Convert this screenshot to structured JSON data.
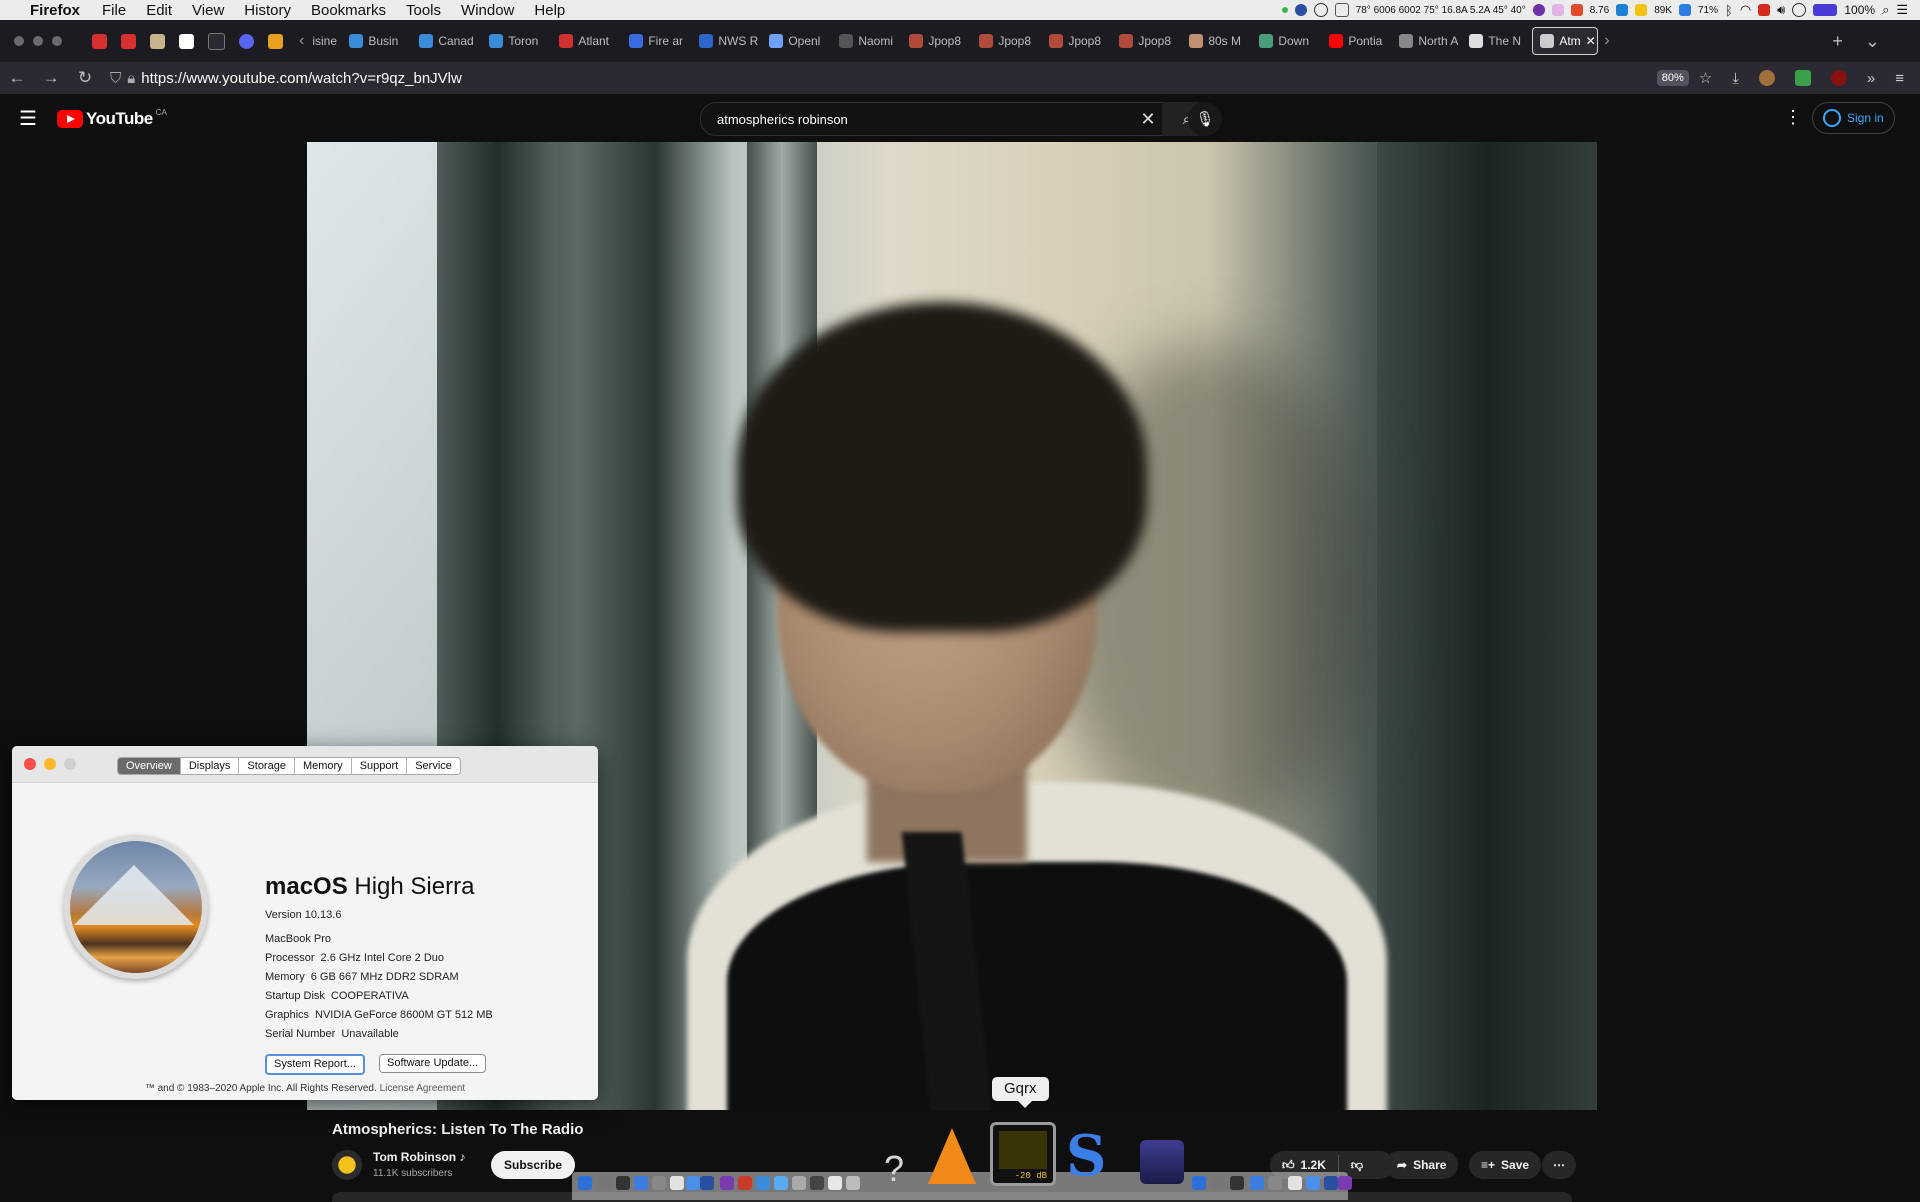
{
  "menubar": {
    "app": "Firefox",
    "items": [
      "File",
      "Edit",
      "View",
      "History",
      "Bookmarks",
      "Tools",
      "Window",
      "Help"
    ],
    "status": {
      "weather": "78° 6006 6002 75° 16.8A 5.2A 45° 40°",
      "stat1": "8.76",
      "stat2": "89K",
      "stat3": "71%",
      "battery": "100%"
    }
  },
  "tabs": [
    {
      "label": "Busin",
      "color": "#3a8bd8"
    },
    {
      "label": "Canad",
      "color": "#3a8bd8"
    },
    {
      "label": "Toron",
      "color": "#3a8bd8"
    },
    {
      "label": "Atlant",
      "color": "#d03030"
    },
    {
      "label": "Fire ar",
      "color": "#3a6be0"
    },
    {
      "label": "NWS R",
      "color": "#2c66c9"
    },
    {
      "label": "Openl",
      "color": "#6fa0ff"
    },
    {
      "label": "Naomi",
      "color": "#555555"
    },
    {
      "label": "Jpop8",
      "color": "#b04a3a"
    },
    {
      "label": "Jpop8",
      "color": "#b04a3a"
    },
    {
      "label": "Jpop8",
      "color": "#b04a3a"
    },
    {
      "label": "Jpop8",
      "color": "#b04a3a"
    },
    {
      "label": "80s M",
      "color": "#c09070"
    },
    {
      "label": "Down",
      "color": "#4a9c7a"
    },
    {
      "label": "Pontia",
      "color": "#ff0000"
    },
    {
      "label": "North Am",
      "color": "#888888"
    },
    {
      "label": "The N",
      "color": "#dddddd"
    },
    {
      "label": "Atm",
      "color": "#cccccc"
    }
  ],
  "tabs_partial": "isine",
  "navbar": {
    "url_prefix": "https://www.",
    "url_domain": "youtube.com",
    "url_path": "/watch?v=r9qz_bnJVlw",
    "zoom": "80%"
  },
  "youtube": {
    "region": "CA",
    "logo_text": "YouTube",
    "search_value": "atmospherics robinson",
    "sign_in": "Sign in",
    "video_title": "Atmospherics: Listen To The Radio",
    "channel": "Tom Robinson",
    "channel_note": "♪",
    "subscribers": "11.1K subscribers",
    "subscribe": "Subscribe",
    "likes": "1.2K",
    "share": "Share",
    "save": "Save"
  },
  "about_mac": {
    "tabs": [
      "Overview",
      "Displays",
      "Storage",
      "Memory",
      "Support",
      "Service"
    ],
    "selected_tab": "Overview",
    "os_first": "macOS",
    "os_second": "High Sierra",
    "version": "Version 10.13.6",
    "model": "MacBook Pro",
    "specs": [
      {
        "label": "Processor",
        "value": "2.6 GHz Intel Core 2 Duo"
      },
      {
        "label": "Memory",
        "value": "6 GB 667 MHz DDR2 SDRAM"
      },
      {
        "label": "Startup Disk",
        "value": "COOPERATIVA"
      },
      {
        "label": "Graphics",
        "value": "NVIDIA GeForce 8600M GT 512 MB"
      },
      {
        "label": "Serial Number",
        "value": "Unavailable"
      }
    ],
    "system_report": "System Report...",
    "software_update": "Software Update...",
    "legal": "™ and © 1983–2020 Apple Inc. All Rights Reserved.",
    "license": "License Agreement"
  },
  "dock": {
    "tooltip": "Gqrx",
    "gqrx_level": "-20 dB"
  },
  "colors": {
    "youtube_red": "#ff0000",
    "link_blue": "#3ea6ff",
    "tab_bg": "#1c1b22",
    "toolbar_bg": "#2b2a33"
  }
}
